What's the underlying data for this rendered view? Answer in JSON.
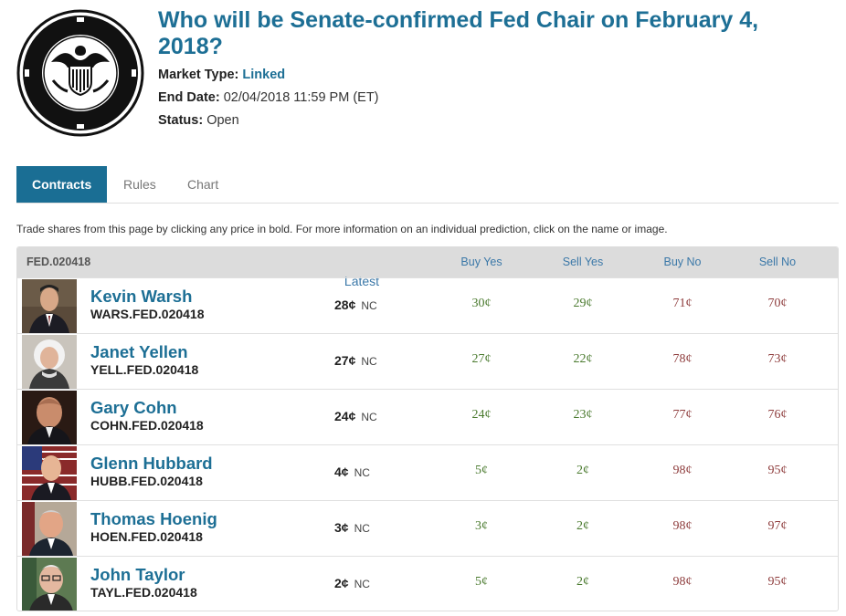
{
  "market": {
    "title": "Who will be Senate-confirmed Fed Chair on February 4, 2018?",
    "market_type_label": "Market Type:",
    "market_type_value": "Linked",
    "end_date_label": "End Date:",
    "end_date_value": "02/04/2018 11:59 PM (ET)",
    "status_label": "Status:",
    "status_value": "Open",
    "seal_icon": "federal-reserve-seal"
  },
  "tabs": [
    {
      "label": "Contracts",
      "active": true
    },
    {
      "label": "Rules",
      "active": false
    },
    {
      "label": "Chart",
      "active": false
    }
  ],
  "intro": "Trade shares from this page by clicking any price in bold. For more information on an individual prediction, click on the name or image.",
  "table": {
    "headers": {
      "code": "FED.020418",
      "latest": "Latest",
      "buy_yes": "Buy Yes",
      "sell_yes": "Sell Yes",
      "buy_no": "Buy No",
      "sell_no": "Sell No"
    },
    "rows": [
      {
        "name": "Kevin Warsh",
        "ticker": "WARS.FED.020418",
        "latest": "28¢",
        "change": "NC",
        "buy_yes": "30¢",
        "sell_yes": "29¢",
        "buy_no": "71¢",
        "sell_no": "70¢"
      },
      {
        "name": "Janet Yellen",
        "ticker": "YELL.FED.020418",
        "latest": "27¢",
        "change": "NC",
        "buy_yes": "27¢",
        "sell_yes": "22¢",
        "buy_no": "78¢",
        "sell_no": "73¢"
      },
      {
        "name": "Gary Cohn",
        "ticker": "COHN.FED.020418",
        "latest": "24¢",
        "change": "NC",
        "buy_yes": "24¢",
        "sell_yes": "23¢",
        "buy_no": "77¢",
        "sell_no": "76¢"
      },
      {
        "name": "Glenn Hubbard",
        "ticker": "HUBB.FED.020418",
        "latest": "4¢",
        "change": "NC",
        "buy_yes": "5¢",
        "sell_yes": "2¢",
        "buy_no": "98¢",
        "sell_no": "95¢"
      },
      {
        "name": "Thomas Hoenig",
        "ticker": "HOEN.FED.020418",
        "latest": "3¢",
        "change": "NC",
        "buy_yes": "3¢",
        "sell_yes": "2¢",
        "buy_no": "98¢",
        "sell_no": "97¢"
      },
      {
        "name": "John Taylor",
        "ticker": "TAYL.FED.020418",
        "latest": "2¢",
        "change": "NC",
        "buy_yes": "5¢",
        "sell_yes": "2¢",
        "buy_no": "98¢",
        "sell_no": "95¢"
      }
    ]
  },
  "colors": {
    "accent": "#1d6f95",
    "active_tab": "#1a6e94",
    "yes_price": "#4a7a2e",
    "no_price": "#8e3c3c",
    "header_bg": "#dcdcdc"
  }
}
